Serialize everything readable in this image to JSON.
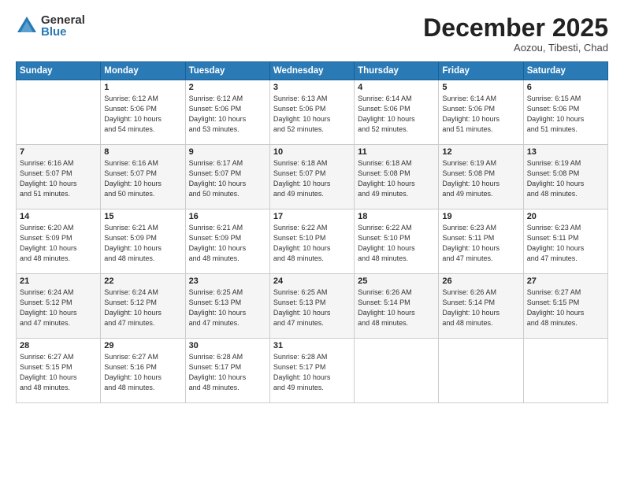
{
  "logo": {
    "general": "General",
    "blue": "Blue"
  },
  "header": {
    "month": "December 2025",
    "location": "Aozou, Tibesti, Chad"
  },
  "days_of_week": [
    "Sunday",
    "Monday",
    "Tuesday",
    "Wednesday",
    "Thursday",
    "Friday",
    "Saturday"
  ],
  "weeks": [
    [
      {
        "day": "",
        "info": ""
      },
      {
        "day": "1",
        "info": "Sunrise: 6:12 AM\nSunset: 5:06 PM\nDaylight: 10 hours\nand 54 minutes."
      },
      {
        "day": "2",
        "info": "Sunrise: 6:12 AM\nSunset: 5:06 PM\nDaylight: 10 hours\nand 53 minutes."
      },
      {
        "day": "3",
        "info": "Sunrise: 6:13 AM\nSunset: 5:06 PM\nDaylight: 10 hours\nand 52 minutes."
      },
      {
        "day": "4",
        "info": "Sunrise: 6:14 AM\nSunset: 5:06 PM\nDaylight: 10 hours\nand 52 minutes."
      },
      {
        "day": "5",
        "info": "Sunrise: 6:14 AM\nSunset: 5:06 PM\nDaylight: 10 hours\nand 51 minutes."
      },
      {
        "day": "6",
        "info": "Sunrise: 6:15 AM\nSunset: 5:06 PM\nDaylight: 10 hours\nand 51 minutes."
      }
    ],
    [
      {
        "day": "7",
        "info": "Sunrise: 6:16 AM\nSunset: 5:07 PM\nDaylight: 10 hours\nand 51 minutes."
      },
      {
        "day": "8",
        "info": "Sunrise: 6:16 AM\nSunset: 5:07 PM\nDaylight: 10 hours\nand 50 minutes."
      },
      {
        "day": "9",
        "info": "Sunrise: 6:17 AM\nSunset: 5:07 PM\nDaylight: 10 hours\nand 50 minutes."
      },
      {
        "day": "10",
        "info": "Sunrise: 6:18 AM\nSunset: 5:07 PM\nDaylight: 10 hours\nand 49 minutes."
      },
      {
        "day": "11",
        "info": "Sunrise: 6:18 AM\nSunset: 5:08 PM\nDaylight: 10 hours\nand 49 minutes."
      },
      {
        "day": "12",
        "info": "Sunrise: 6:19 AM\nSunset: 5:08 PM\nDaylight: 10 hours\nand 49 minutes."
      },
      {
        "day": "13",
        "info": "Sunrise: 6:19 AM\nSunset: 5:08 PM\nDaylight: 10 hours\nand 48 minutes."
      }
    ],
    [
      {
        "day": "14",
        "info": "Sunrise: 6:20 AM\nSunset: 5:09 PM\nDaylight: 10 hours\nand 48 minutes."
      },
      {
        "day": "15",
        "info": "Sunrise: 6:21 AM\nSunset: 5:09 PM\nDaylight: 10 hours\nand 48 minutes."
      },
      {
        "day": "16",
        "info": "Sunrise: 6:21 AM\nSunset: 5:09 PM\nDaylight: 10 hours\nand 48 minutes."
      },
      {
        "day": "17",
        "info": "Sunrise: 6:22 AM\nSunset: 5:10 PM\nDaylight: 10 hours\nand 48 minutes."
      },
      {
        "day": "18",
        "info": "Sunrise: 6:22 AM\nSunset: 5:10 PM\nDaylight: 10 hours\nand 48 minutes."
      },
      {
        "day": "19",
        "info": "Sunrise: 6:23 AM\nSunset: 5:11 PM\nDaylight: 10 hours\nand 47 minutes."
      },
      {
        "day": "20",
        "info": "Sunrise: 6:23 AM\nSunset: 5:11 PM\nDaylight: 10 hours\nand 47 minutes."
      }
    ],
    [
      {
        "day": "21",
        "info": "Sunrise: 6:24 AM\nSunset: 5:12 PM\nDaylight: 10 hours\nand 47 minutes."
      },
      {
        "day": "22",
        "info": "Sunrise: 6:24 AM\nSunset: 5:12 PM\nDaylight: 10 hours\nand 47 minutes."
      },
      {
        "day": "23",
        "info": "Sunrise: 6:25 AM\nSunset: 5:13 PM\nDaylight: 10 hours\nand 47 minutes."
      },
      {
        "day": "24",
        "info": "Sunrise: 6:25 AM\nSunset: 5:13 PM\nDaylight: 10 hours\nand 47 minutes."
      },
      {
        "day": "25",
        "info": "Sunrise: 6:26 AM\nSunset: 5:14 PM\nDaylight: 10 hours\nand 48 minutes."
      },
      {
        "day": "26",
        "info": "Sunrise: 6:26 AM\nSunset: 5:14 PM\nDaylight: 10 hours\nand 48 minutes."
      },
      {
        "day": "27",
        "info": "Sunrise: 6:27 AM\nSunset: 5:15 PM\nDaylight: 10 hours\nand 48 minutes."
      }
    ],
    [
      {
        "day": "28",
        "info": "Sunrise: 6:27 AM\nSunset: 5:15 PM\nDaylight: 10 hours\nand 48 minutes."
      },
      {
        "day": "29",
        "info": "Sunrise: 6:27 AM\nSunset: 5:16 PM\nDaylight: 10 hours\nand 48 minutes."
      },
      {
        "day": "30",
        "info": "Sunrise: 6:28 AM\nSunset: 5:17 PM\nDaylight: 10 hours\nand 48 minutes."
      },
      {
        "day": "31",
        "info": "Sunrise: 6:28 AM\nSunset: 5:17 PM\nDaylight: 10 hours\nand 49 minutes."
      },
      {
        "day": "",
        "info": ""
      },
      {
        "day": "",
        "info": ""
      },
      {
        "day": "",
        "info": ""
      }
    ]
  ]
}
